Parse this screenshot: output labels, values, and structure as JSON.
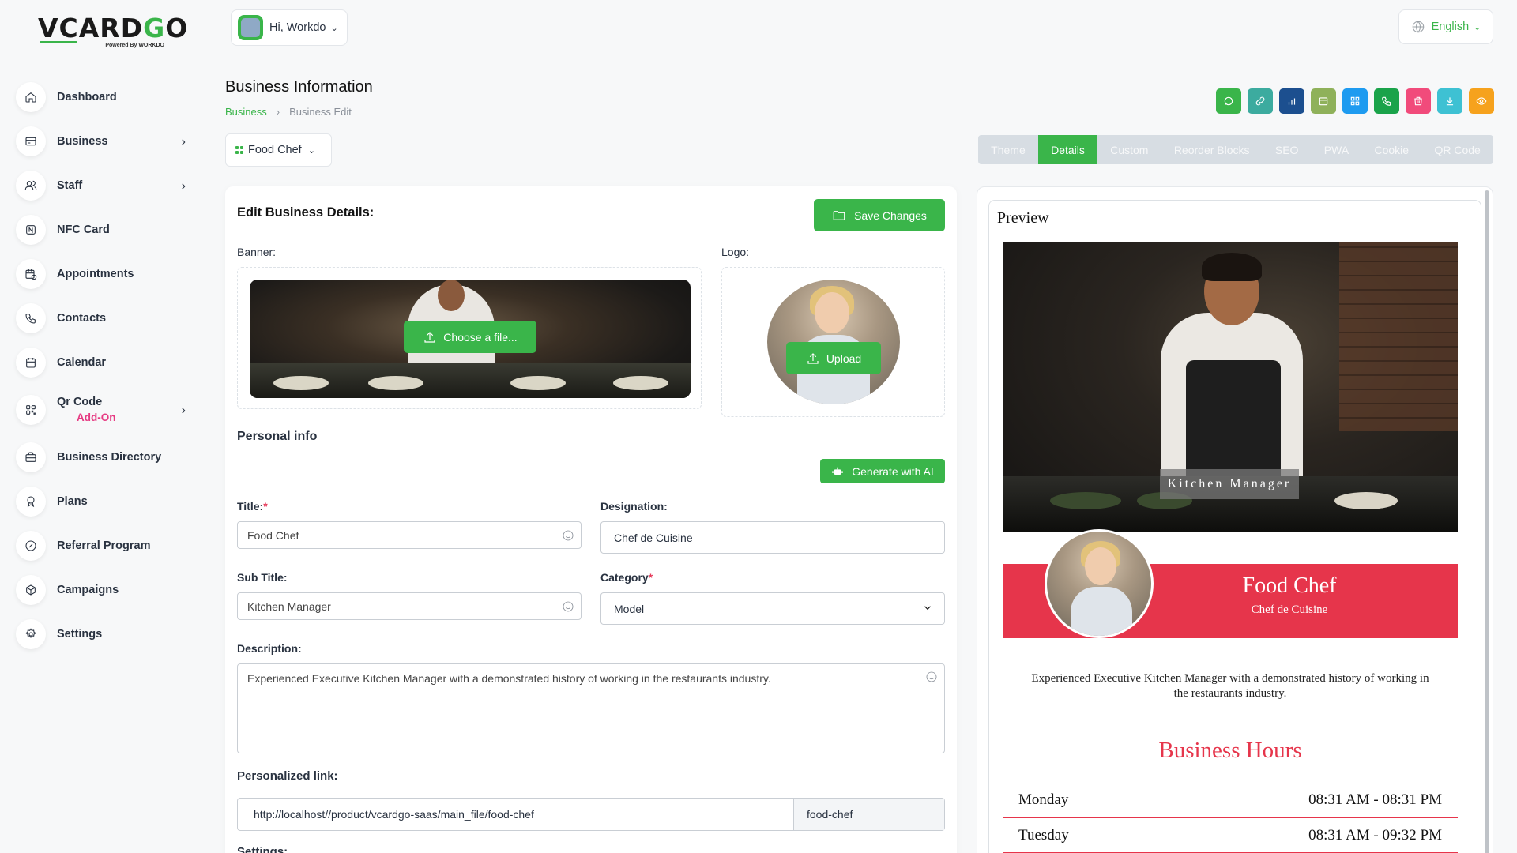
{
  "brand": {
    "logo_main": "VCARDGO",
    "logo_sub": "Powered By WORKDO"
  },
  "sidebar": {
    "items": [
      {
        "label": "Dashboard",
        "icon": "home-icon",
        "has_arrow": false
      },
      {
        "label": "Business",
        "icon": "card-icon",
        "has_arrow": true
      },
      {
        "label": "Staff",
        "icon": "users-icon",
        "has_arrow": true
      },
      {
        "label": "NFC Card",
        "icon": "nfc-icon",
        "has_arrow": false
      },
      {
        "label": "Appointments",
        "icon": "calendar-time-icon",
        "has_arrow": false
      },
      {
        "label": "Contacts",
        "icon": "phone-icon",
        "has_arrow": false
      },
      {
        "label": "Calendar",
        "icon": "calendar-icon",
        "has_arrow": false
      },
      {
        "label": "Qr Code",
        "sublabel": "Add-On",
        "icon": "qrcode-icon",
        "has_arrow": true
      },
      {
        "label": "Business Directory",
        "icon": "briefcase-icon",
        "has_arrow": false
      },
      {
        "label": "Plans",
        "icon": "award-icon",
        "has_arrow": false
      },
      {
        "label": "Referral Program",
        "icon": "discount-icon",
        "has_arrow": false
      },
      {
        "label": "Campaigns",
        "icon": "box-icon",
        "has_arrow": false
      },
      {
        "label": "Settings",
        "icon": "gear-icon",
        "has_arrow": false
      }
    ]
  },
  "header": {
    "greeting": "Hi, Workdo",
    "language": "English"
  },
  "page": {
    "title": "Business Information",
    "breadcrumb": [
      "Business",
      "Business Edit"
    ],
    "business_selector": "Food Chef"
  },
  "actions": [
    {
      "name": "whatsapp-icon",
      "color": "#3ab54a"
    },
    {
      "name": "link-icon",
      "color": "#3cab9f"
    },
    {
      "name": "chart-icon",
      "color": "#1c4f8f"
    },
    {
      "name": "calendar-icon",
      "color": "#8fb15a"
    },
    {
      "name": "qrcode-icon",
      "color": "#1e9bf0"
    },
    {
      "name": "phone-icon",
      "color": "#1aa34a"
    },
    {
      "name": "trash-icon",
      "color": "#f14b7b"
    },
    {
      "name": "download-icon",
      "color": "#3ec1d3"
    },
    {
      "name": "eye-icon",
      "color": "#f6a21d"
    }
  ],
  "tabs": [
    {
      "label": "Theme",
      "active": false
    },
    {
      "label": "Details",
      "active": true
    },
    {
      "label": "Custom",
      "active": false
    },
    {
      "label": "Reorder Blocks",
      "active": false
    },
    {
      "label": "SEO",
      "active": false
    },
    {
      "label": "PWA",
      "active": false
    },
    {
      "label": "Cookie",
      "active": false
    },
    {
      "label": "QR Code",
      "active": false
    }
  ],
  "form": {
    "heading": "Edit Business Details:",
    "save_label": "Save Changes",
    "banner_label": "Banner:",
    "logo_label": "Logo:",
    "choose_file_label": "Choose a file...",
    "upload_label": "Upload",
    "personal_info": "Personal info",
    "generate_ai": "Generate with AI",
    "title_label": "Title:",
    "title_value": "Food Chef",
    "designation_label": "Designation:",
    "designation_value": "Chef de Cuisine",
    "subtitle_label": "Sub Title:",
    "subtitle_value": "Kitchen Manager",
    "category_label": "Category",
    "category_value": "Model",
    "description_label": "Description:",
    "description_value": "Experienced Executive Kitchen Manager with a demonstrated history of working in the restaurants industry.",
    "link_label": "Personalized link:",
    "link_url": "http://localhost//product/vcardgo-saas/main_file/food-chef",
    "link_slug": "food-chef",
    "settings_label": "Settings:"
  },
  "preview": {
    "title": "Preview",
    "banner_tag": "Kitchen Manager",
    "name": "Food Chef",
    "designation": "Chef de Cuisine",
    "description": "Experienced Executive Kitchen Manager with a demonstrated history of working in the restaurants industry.",
    "hours_title": "Business Hours",
    "hours": [
      {
        "day": "Monday",
        "time": "08:31 AM - 08:31 PM"
      },
      {
        "day": "Tuesday",
        "time": "08:31 AM - 09:32 PM"
      }
    ],
    "accent": "#e6354b"
  },
  "colors": {
    "primary": "#3ab54a"
  }
}
